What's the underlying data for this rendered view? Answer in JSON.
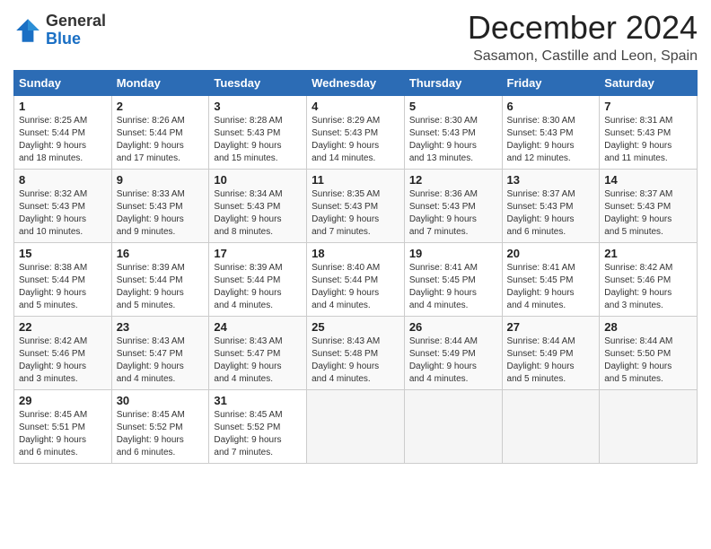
{
  "header": {
    "logo_general": "General",
    "logo_blue": "Blue",
    "month_title": "December 2024",
    "location": "Sasamon, Castille and Leon, Spain"
  },
  "days_of_week": [
    "Sunday",
    "Monday",
    "Tuesday",
    "Wednesday",
    "Thursday",
    "Friday",
    "Saturday"
  ],
  "weeks": [
    [
      {
        "day": 1,
        "info": "Sunrise: 8:25 AM\nSunset: 5:44 PM\nDaylight: 9 hours\nand 18 minutes."
      },
      {
        "day": 2,
        "info": "Sunrise: 8:26 AM\nSunset: 5:44 PM\nDaylight: 9 hours\nand 17 minutes."
      },
      {
        "day": 3,
        "info": "Sunrise: 8:28 AM\nSunset: 5:43 PM\nDaylight: 9 hours\nand 15 minutes."
      },
      {
        "day": 4,
        "info": "Sunrise: 8:29 AM\nSunset: 5:43 PM\nDaylight: 9 hours\nand 14 minutes."
      },
      {
        "day": 5,
        "info": "Sunrise: 8:30 AM\nSunset: 5:43 PM\nDaylight: 9 hours\nand 13 minutes."
      },
      {
        "day": 6,
        "info": "Sunrise: 8:30 AM\nSunset: 5:43 PM\nDaylight: 9 hours\nand 12 minutes."
      },
      {
        "day": 7,
        "info": "Sunrise: 8:31 AM\nSunset: 5:43 PM\nDaylight: 9 hours\nand 11 minutes."
      }
    ],
    [
      {
        "day": 8,
        "info": "Sunrise: 8:32 AM\nSunset: 5:43 PM\nDaylight: 9 hours\nand 10 minutes."
      },
      {
        "day": 9,
        "info": "Sunrise: 8:33 AM\nSunset: 5:43 PM\nDaylight: 9 hours\nand 9 minutes."
      },
      {
        "day": 10,
        "info": "Sunrise: 8:34 AM\nSunset: 5:43 PM\nDaylight: 9 hours\nand 8 minutes."
      },
      {
        "day": 11,
        "info": "Sunrise: 8:35 AM\nSunset: 5:43 PM\nDaylight: 9 hours\nand 7 minutes."
      },
      {
        "day": 12,
        "info": "Sunrise: 8:36 AM\nSunset: 5:43 PM\nDaylight: 9 hours\nand 7 minutes."
      },
      {
        "day": 13,
        "info": "Sunrise: 8:37 AM\nSunset: 5:43 PM\nDaylight: 9 hours\nand 6 minutes."
      },
      {
        "day": 14,
        "info": "Sunrise: 8:37 AM\nSunset: 5:43 PM\nDaylight: 9 hours\nand 5 minutes."
      }
    ],
    [
      {
        "day": 15,
        "info": "Sunrise: 8:38 AM\nSunset: 5:44 PM\nDaylight: 9 hours\nand 5 minutes."
      },
      {
        "day": 16,
        "info": "Sunrise: 8:39 AM\nSunset: 5:44 PM\nDaylight: 9 hours\nand 5 minutes."
      },
      {
        "day": 17,
        "info": "Sunrise: 8:39 AM\nSunset: 5:44 PM\nDaylight: 9 hours\nand 4 minutes."
      },
      {
        "day": 18,
        "info": "Sunrise: 8:40 AM\nSunset: 5:44 PM\nDaylight: 9 hours\nand 4 minutes."
      },
      {
        "day": 19,
        "info": "Sunrise: 8:41 AM\nSunset: 5:45 PM\nDaylight: 9 hours\nand 4 minutes."
      },
      {
        "day": 20,
        "info": "Sunrise: 8:41 AM\nSunset: 5:45 PM\nDaylight: 9 hours\nand 4 minutes."
      },
      {
        "day": 21,
        "info": "Sunrise: 8:42 AM\nSunset: 5:46 PM\nDaylight: 9 hours\nand 3 minutes."
      }
    ],
    [
      {
        "day": 22,
        "info": "Sunrise: 8:42 AM\nSunset: 5:46 PM\nDaylight: 9 hours\nand 3 minutes."
      },
      {
        "day": 23,
        "info": "Sunrise: 8:43 AM\nSunset: 5:47 PM\nDaylight: 9 hours\nand 4 minutes."
      },
      {
        "day": 24,
        "info": "Sunrise: 8:43 AM\nSunset: 5:47 PM\nDaylight: 9 hours\nand 4 minutes."
      },
      {
        "day": 25,
        "info": "Sunrise: 8:43 AM\nSunset: 5:48 PM\nDaylight: 9 hours\nand 4 minutes."
      },
      {
        "day": 26,
        "info": "Sunrise: 8:44 AM\nSunset: 5:49 PM\nDaylight: 9 hours\nand 4 minutes."
      },
      {
        "day": 27,
        "info": "Sunrise: 8:44 AM\nSunset: 5:49 PM\nDaylight: 9 hours\nand 5 minutes."
      },
      {
        "day": 28,
        "info": "Sunrise: 8:44 AM\nSunset: 5:50 PM\nDaylight: 9 hours\nand 5 minutes."
      }
    ],
    [
      {
        "day": 29,
        "info": "Sunrise: 8:45 AM\nSunset: 5:51 PM\nDaylight: 9 hours\nand 6 minutes."
      },
      {
        "day": 30,
        "info": "Sunrise: 8:45 AM\nSunset: 5:52 PM\nDaylight: 9 hours\nand 6 minutes."
      },
      {
        "day": 31,
        "info": "Sunrise: 8:45 AM\nSunset: 5:52 PM\nDaylight: 9 hours\nand 7 minutes."
      },
      null,
      null,
      null,
      null
    ]
  ]
}
